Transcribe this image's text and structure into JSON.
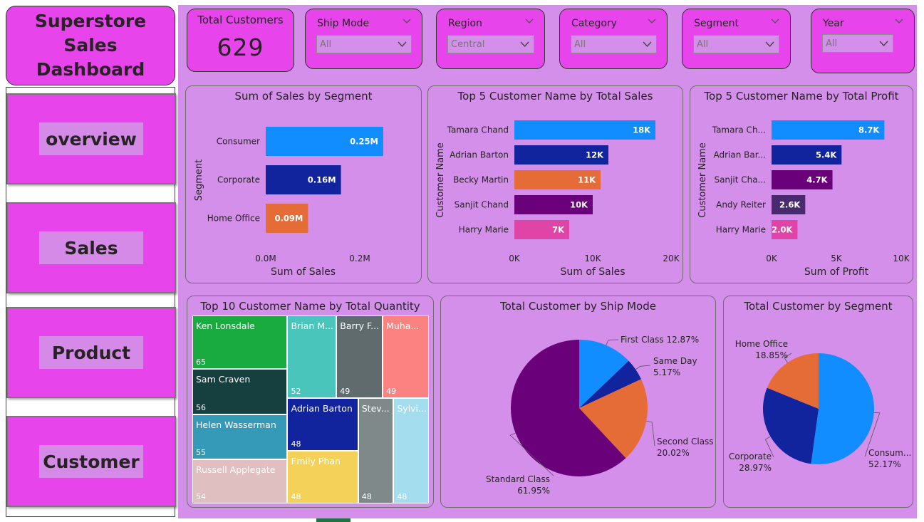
{
  "dashboard_title": "Superstore Sales\nDashboard",
  "nav": [
    {
      "label": "overview"
    },
    {
      "label": "Sales"
    },
    {
      "label": "Product"
    },
    {
      "label": "Customer"
    }
  ],
  "kpi": {
    "title": "Total Customers",
    "value": "629"
  },
  "slicers": [
    {
      "title": "Ship Mode",
      "value": "All"
    },
    {
      "title": "Region",
      "value": "Central"
    },
    {
      "title": "Category",
      "value": "All"
    },
    {
      "title": "Segment",
      "value": "All"
    },
    {
      "title": "Year",
      "value": "All"
    }
  ],
  "colors": {
    "nav_bg": "#e844ec",
    "canvas_bg": "#d48fea",
    "blue": "#118dff",
    "dark_blue": "#12239e",
    "orange": "#e66c37",
    "purple": "#6b007b",
    "violet": "#4a2a6e",
    "pink": "#e044a7"
  },
  "chart_data": [
    {
      "type": "bar",
      "title": "Sum of Sales by Segment",
      "xlabel": "Sum of Sales",
      "ylabel": "Segment",
      "categories": [
        "Consumer",
        "Corporate",
        "Home Office"
      ],
      "values": [
        0.25,
        0.16,
        0.09
      ],
      "data_labels": [
        "0.25M",
        "0.16M",
        "0.09M"
      ],
      "bar_colors": [
        "#118dff",
        "#12239e",
        "#e66c37"
      ],
      "x_ticks": [
        "0.0M",
        "0.2M"
      ],
      "xlim": [
        0,
        0.25
      ]
    },
    {
      "type": "bar",
      "title": "Top 5 Customer Name by Total Sales",
      "xlabel": "Sum of Sales",
      "ylabel": "Customer Name",
      "categories": [
        "Tamara Chand",
        "Adrian Barton",
        "Becky Martin",
        "Sanjit Chand",
        "Harry Marie"
      ],
      "values": [
        18,
        12,
        11,
        10,
        7
      ],
      "data_labels": [
        "18K",
        "12K",
        "11K",
        "10K",
        "7K"
      ],
      "bar_colors": [
        "#118dff",
        "#12239e",
        "#e66c37",
        "#6b007b",
        "#e044a7"
      ],
      "x_ticks": [
        "0K",
        "10K",
        "20K"
      ],
      "xlim": [
        0,
        20
      ]
    },
    {
      "type": "bar",
      "title": "Top 5 Customer Name by Total Profit",
      "xlabel": "Sum of Profit",
      "ylabel": "Customer Name",
      "categories": [
        "Tamara Ch...",
        "Adrian Bar...",
        "Sanjit Cha...",
        "Andy Reiter",
        "Harry Marie"
      ],
      "values": [
        8.7,
        5.4,
        4.7,
        2.6,
        2.0
      ],
      "data_labels": [
        "8.7K",
        "5.4K",
        "4.7K",
        "2.6K",
        "2.0K"
      ],
      "bar_colors": [
        "#118dff",
        "#12239e",
        "#6b007b",
        "#4a2a6e",
        "#e044a7"
      ],
      "x_ticks": [
        "0K",
        "5K",
        "10K"
      ],
      "xlim": [
        0,
        10
      ]
    },
    {
      "type": "treemap",
      "title": "Top 10 Customer Name by Total Quantity",
      "items": [
        {
          "name": "Ken Lonsdale",
          "value": 65,
          "color": "#1aab40"
        },
        {
          "name": "Sam Craven",
          "value": 56,
          "color": "#15403f"
        },
        {
          "name": "Helen Wasserman",
          "value": 55,
          "color": "#3599b8"
        },
        {
          "name": "Russell Applegate",
          "value": 54,
          "color": "#dfbfbf"
        },
        {
          "name": "Brian M...",
          "value": 52,
          "color": "#4ac5bb"
        },
        {
          "name": "Barry F...",
          "value": 49,
          "color": "#5f6b6d"
        },
        {
          "name": "Muha...",
          "value": 49,
          "color": "#fb8281"
        },
        {
          "name": "Adrian Barton",
          "value": 48,
          "color": "#12239e"
        },
        {
          "name": "Emily Phan",
          "value": 48,
          "color": "#f4d25a"
        },
        {
          "name": "Stev...",
          "value": 48,
          "color": "#7f898a"
        },
        {
          "name": "Sylvi...",
          "value": 48,
          "color": "#a4ddee"
        }
      ]
    },
    {
      "type": "pie",
      "title": "Total Customer by Ship Mode",
      "slices": [
        {
          "label": "First Class",
          "value": 12.87,
          "text": "12.87%",
          "color": "#118dff"
        },
        {
          "label": "Same Day",
          "value": 5.17,
          "text": "5.17%",
          "color": "#12239e"
        },
        {
          "label": "Second Class",
          "value": 20.02,
          "text": "20.02%",
          "color": "#e66c37"
        },
        {
          "label": "Standard Class",
          "value": 61.95,
          "text": "61.95%",
          "color": "#6b007b"
        }
      ]
    },
    {
      "type": "pie",
      "title": "Total Customer by Segment",
      "slices": [
        {
          "label": "Consum...",
          "value": 52.17,
          "text": "52.17%",
          "color": "#118dff"
        },
        {
          "label": "Corporate",
          "value": 28.97,
          "text": "28.97%",
          "color": "#12239e"
        },
        {
          "label": "Home Office",
          "value": 18.85,
          "text": "18.85%",
          "color": "#e66c37"
        }
      ]
    }
  ]
}
